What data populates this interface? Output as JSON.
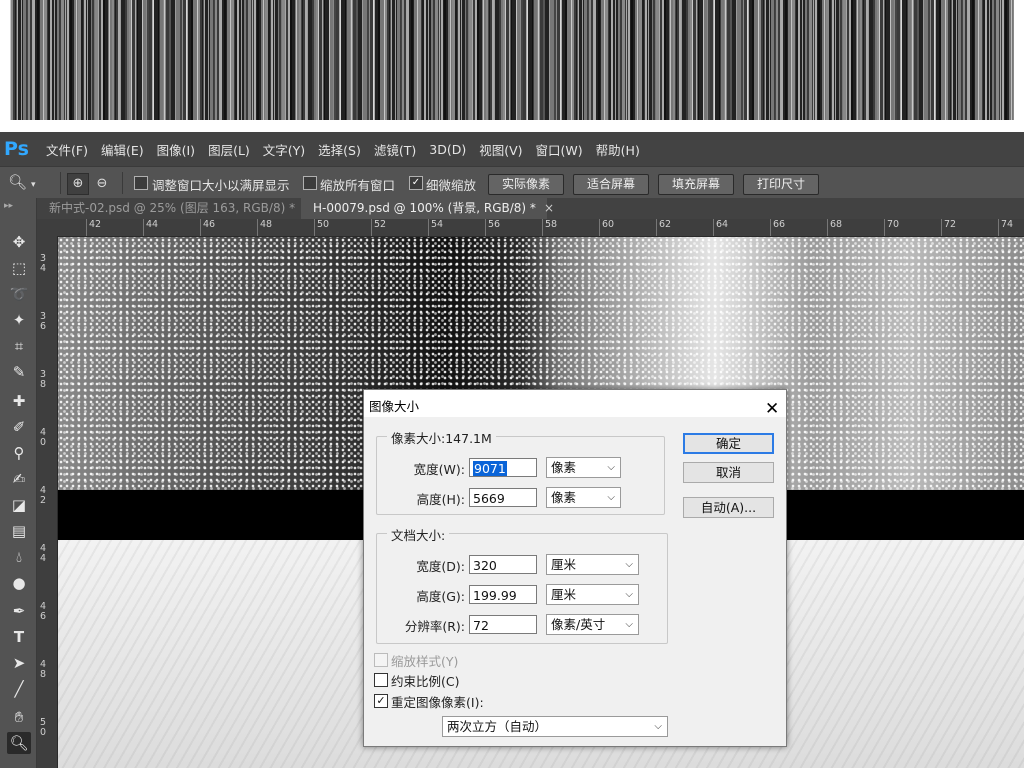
{
  "app": {
    "logo": "Ps",
    "menus": [
      "文件(F)",
      "编辑(E)",
      "图像(I)",
      "图层(L)",
      "文字(Y)",
      "选择(S)",
      "滤镜(T)",
      "3D(D)",
      "视图(V)",
      "窗口(W)",
      "帮助(H)"
    ]
  },
  "options": {
    "tool_icon": "magnifier-icon",
    "resize_windows": "调整窗口大小以满屏显示",
    "zoom_all": "缩放所有窗口",
    "scrubby_zoom": "细微缩放",
    "resize_windows_checked": false,
    "zoom_all_checked": false,
    "scrubby_zoom_checked": true,
    "buttons": [
      "实际像素",
      "适合屏幕",
      "填充屏幕",
      "打印尺寸"
    ]
  },
  "tabs": [
    {
      "label": "新中式-02.psd @ 25% (图层 163, RGB/8) *",
      "active": false
    },
    {
      "label": "H-00079.psd @ 100% (背景, RGB/8) *",
      "active": true
    }
  ],
  "ruler": {
    "h_labels": [
      "42",
      "44",
      "46",
      "48",
      "50",
      "52",
      "54",
      "56",
      "58",
      "60",
      "62",
      "64",
      "66",
      "68",
      "70",
      "72",
      "74"
    ],
    "v_labels": [
      "34",
      "36",
      "38",
      "40",
      "42",
      "44",
      "46",
      "48",
      "50"
    ]
  },
  "dialog": {
    "title": "图像大小",
    "pixel_dims_label": "像素大小:147.1M",
    "width_label": "宽度(W):",
    "width_value": "9071",
    "width_unit": "像素",
    "height_label": "高度(H):",
    "height_value": "5669",
    "height_unit": "像素",
    "doc_size_label": "文档大小:",
    "doc_width_label": "宽度(D):",
    "doc_width_value": "320",
    "doc_width_unit": "厘米",
    "doc_height_label": "高度(G):",
    "doc_height_value": "199.99",
    "doc_height_unit": "厘米",
    "resolution_label": "分辨率(R):",
    "resolution_value": "72",
    "resolution_unit": "像素/英寸",
    "ok": "确定",
    "cancel": "取消",
    "auto": "自动(A)...",
    "scale_styles": "缩放样式(Y)",
    "constrain": "约束比例(C)",
    "resample": "重定图像像素(I):",
    "constrain_checked": false,
    "resample_checked": true,
    "scale_styles_enabled": false,
    "resample_method": "两次立方（自动）"
  }
}
